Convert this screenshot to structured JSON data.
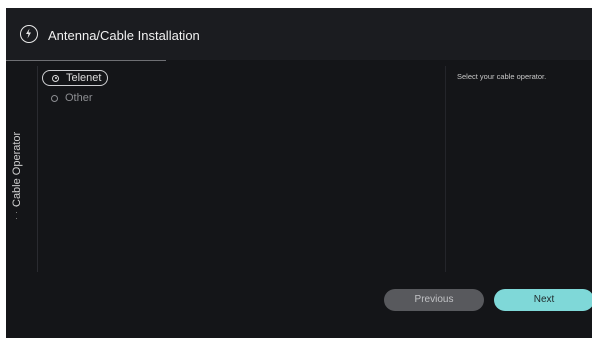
{
  "header": {
    "title": "Antenna/Cable Installation",
    "icon": "antenna-plug-icon"
  },
  "side_panel": {
    "label": "Cable Operator",
    "dots": "⋮"
  },
  "options": [
    {
      "label": "Telenet",
      "selected": true
    },
    {
      "label": "Other",
      "selected": false
    }
  ],
  "help": {
    "text": "Select your cable operator."
  },
  "buttons": {
    "previous_label": "Previous",
    "next_label": "Next"
  },
  "colors": {
    "background": "#141518",
    "accent": "#7fd8d8",
    "secondary_button": "#58595d"
  }
}
